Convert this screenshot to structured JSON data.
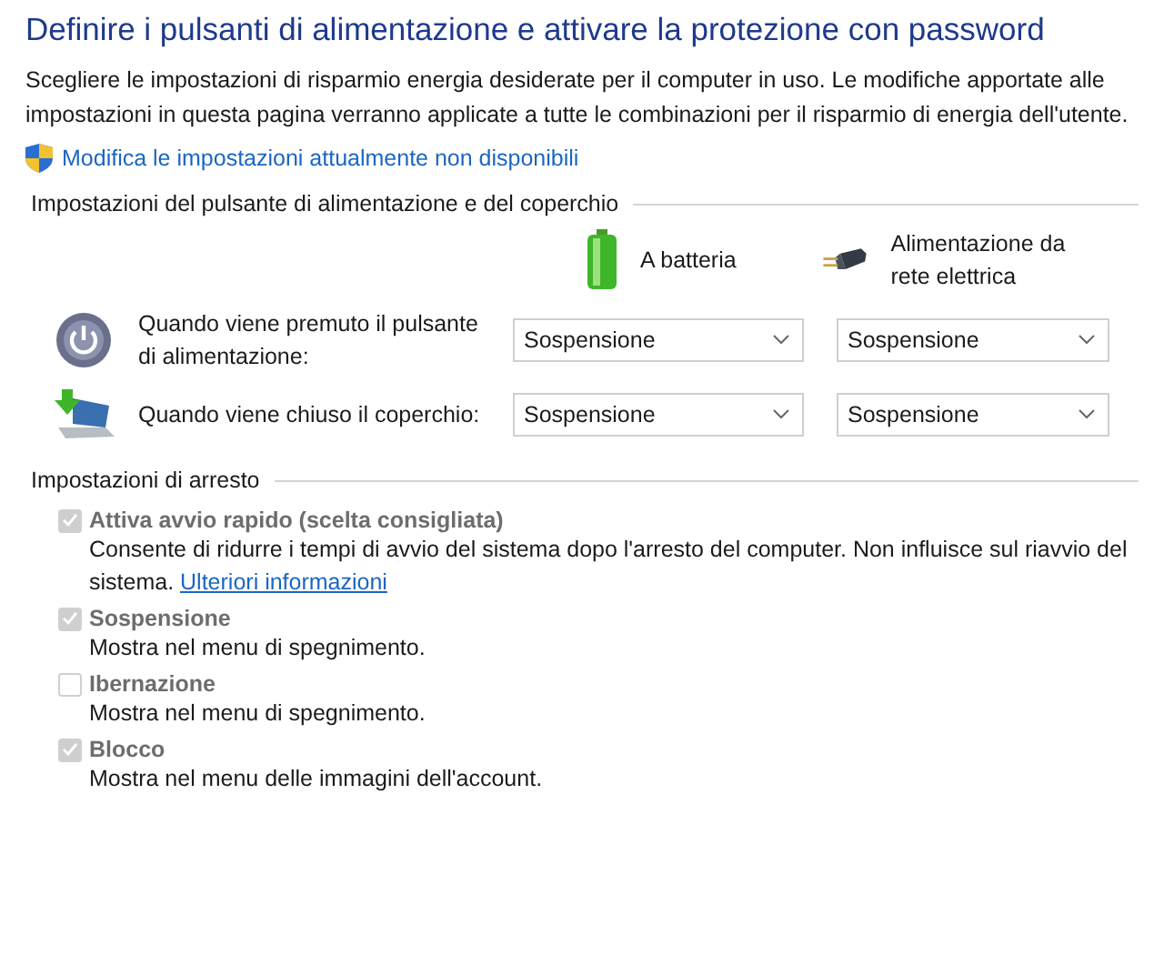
{
  "title": "Definire i pulsanti di alimentazione e attivare la protezione con password",
  "intro": "Scegliere le impostazioni di risparmio energia desiderate per il computer in uso. Le modifiche apportate alle impostazioni in questa pagina verranno applicate a tutte le combinazioni per il risparmio di energia dell'utente.",
  "admin_link": "Modifica le impostazioni attualmente non disponibili",
  "buttons_section": {
    "heading": "Impostazioni del pulsante di alimentazione e del coperchio",
    "columns": [
      {
        "kind": "battery",
        "label": "A batteria"
      },
      {
        "kind": "plug",
        "label": "Alimentazione da rete elettrica"
      }
    ],
    "rows": [
      {
        "kind": "power",
        "label": "Quando viene premuto il pulsante di alimentazione:",
        "values": [
          "Sospensione",
          "Sospensione"
        ]
      },
      {
        "kind": "lid",
        "label": "Quando viene chiuso il coperchio:",
        "values": [
          "Sospensione",
          "Sospensione"
        ]
      }
    ]
  },
  "shutdown_section": {
    "heading": "Impostazioni di arresto",
    "options": [
      {
        "label": "Attiva avvio rapido (scelta consigliata)",
        "checked": true,
        "disabled": true,
        "description": "Consente di ridurre i tempi di avvio del sistema dopo l'arresto del computer. Non influisce sul riavvio del sistema.",
        "link": "Ulteriori informazioni"
      },
      {
        "label": "Sospensione",
        "checked": true,
        "disabled": true,
        "description": "Mostra nel menu di spegnimento."
      },
      {
        "label": "Ibernazione",
        "checked": false,
        "disabled": true,
        "description": "Mostra nel menu di spegnimento."
      },
      {
        "label": "Blocco",
        "checked": true,
        "disabled": true,
        "description": "Mostra nel menu delle immagini dell'account."
      }
    ]
  }
}
